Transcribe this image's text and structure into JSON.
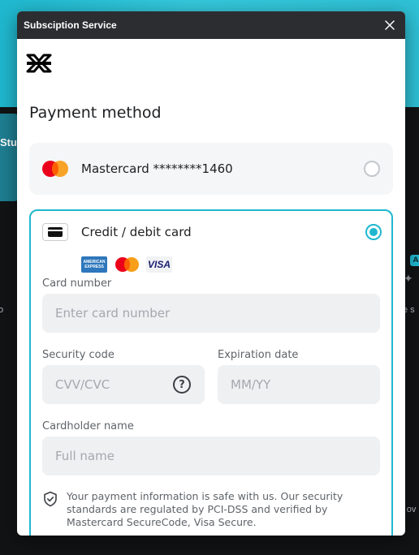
{
  "background": {
    "card_text": "Stu",
    "left_text": "o",
    "right_badge": "A",
    "right_text": "e s",
    "right_text2": "r ov"
  },
  "window": {
    "title": "Subsciption Service"
  },
  "heading": "Payment method",
  "saved_card": {
    "label": "Mastercard ********1460",
    "selected": false
  },
  "card_form": {
    "label": "Credit / debit card",
    "selected": true,
    "brands": {
      "amex_line1": "AMERICAN",
      "amex_line2": "EXPRESS",
      "visa": "VISA"
    },
    "card_number": {
      "label": "Card number",
      "placeholder": "Enter card number"
    },
    "security_code": {
      "label": "Security code",
      "placeholder": "CVV/CVC",
      "help": "?"
    },
    "expiration": {
      "label": "Expiration date",
      "placeholder": "MM/YY"
    },
    "cardholder": {
      "label": "Cardholder name",
      "placeholder": "Full name"
    },
    "security_note": "Your payment information is safe with us. Our security standards are regulated by PCI-DSS and verified by Mastercard SecureCode, Visa Secure."
  },
  "colors": {
    "accent": "#1fb8cf",
    "titlebar": "#2b2d31"
  }
}
